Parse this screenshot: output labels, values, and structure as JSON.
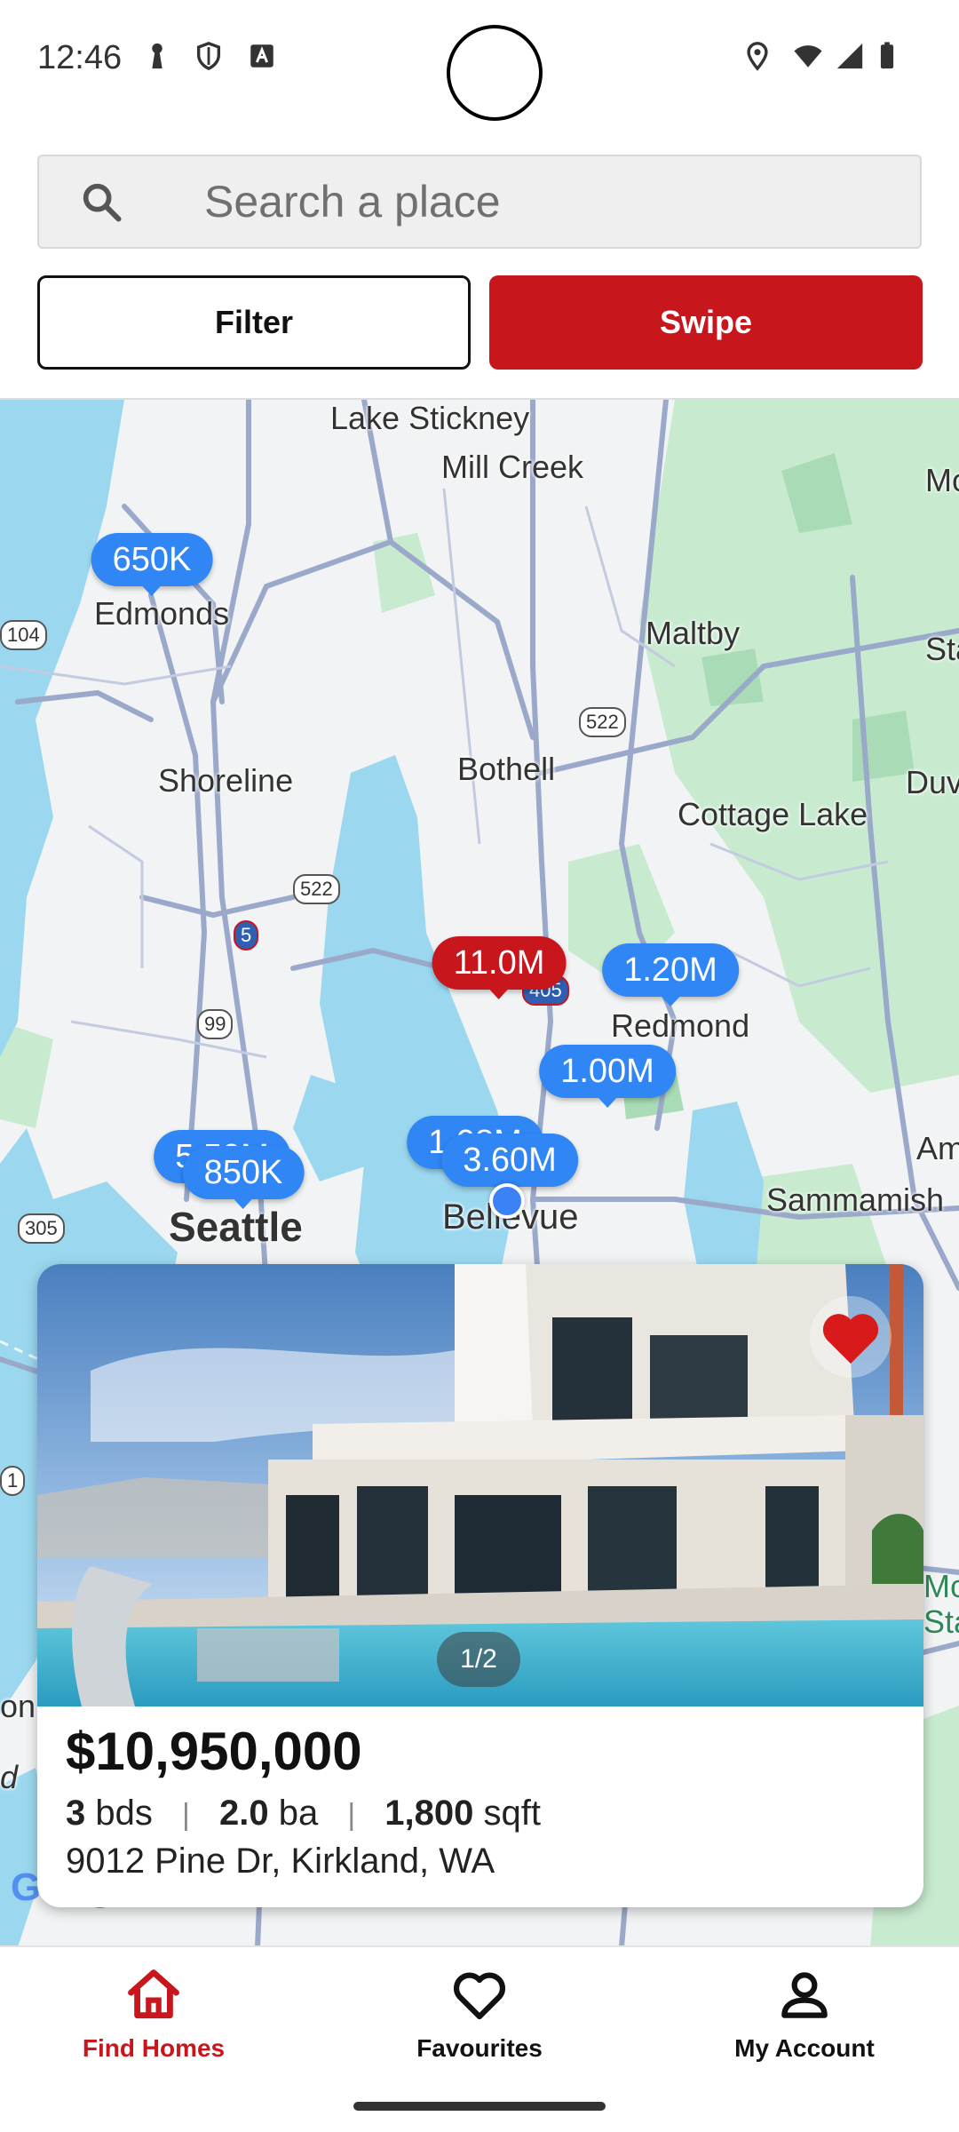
{
  "status_bar": {
    "time": "12:46",
    "left_icons": [
      "keyhole-icon",
      "shield-icon",
      "font-icon"
    ],
    "right_icons": [
      "location-icon",
      "wifi-icon",
      "signal-icon",
      "battery-icon"
    ]
  },
  "search": {
    "placeholder": "Search a place",
    "value": ""
  },
  "actions": {
    "filter_label": "Filter",
    "swipe_label": "Swipe"
  },
  "map": {
    "place_labels": {
      "lake_stickney": "Lake Stickney",
      "mill_creek": "Mill Creek",
      "edmonds": "Edmonds",
      "maltby": "Maltby",
      "shoreline": "Shoreline",
      "bothell": "Bothell",
      "cottage_lake": "Cottage Lake",
      "duvall": "Duva",
      "redmond": "Redmond",
      "seattle": "Seattle",
      "bellevue": "Bellevue",
      "sammamish": "Sammamish",
      "ames": "Am",
      "monroe": "Mo",
      "mc": "Mc",
      "stat": "Stat",
      "stat_top": "Sta",
      "on": "on",
      "d": "d"
    },
    "road_shields": {
      "r104": "104",
      "r522a": "522",
      "r522b": "522",
      "i5": "5",
      "r99": "99",
      "r405": "405",
      "r305": "305",
      "r1": "1"
    },
    "price_pins": [
      {
        "label": "650K",
        "selected": false
      },
      {
        "label": "11.0M",
        "selected": true
      },
      {
        "label": "1.20M",
        "selected": false
      },
      {
        "label": "1.00M",
        "selected": false
      },
      {
        "label": "5.50M",
        "selected": false
      },
      {
        "label": "850K",
        "selected": false
      },
      {
        "label": "1.08M",
        "selected": false
      },
      {
        "label": "3.60M",
        "selected": false
      }
    ],
    "attribution": "Google"
  },
  "listing": {
    "price": "$10,950,000",
    "beds": "3",
    "beds_unit": "bds",
    "baths": "2.0",
    "baths_unit": "ba",
    "sqft": "1,800",
    "sqft_unit": "sqft",
    "address": "9012 Pine Dr, Kirkland, WA",
    "photo_counter": "1/2",
    "favourited": true,
    "separator": "|"
  },
  "bottom_nav": {
    "items": [
      {
        "label": "Find Homes",
        "icon": "home-icon",
        "active": true
      },
      {
        "label": "Favourites",
        "icon": "heart-icon",
        "active": false
      },
      {
        "label": "My Account",
        "icon": "person-icon",
        "active": false
      }
    ]
  },
  "colors": {
    "accent": "#c8161d",
    "pin_blue": "#2f86f4",
    "water": "#9bd8f0",
    "land": "#f1f3f4",
    "park": "#c8ebcf"
  }
}
